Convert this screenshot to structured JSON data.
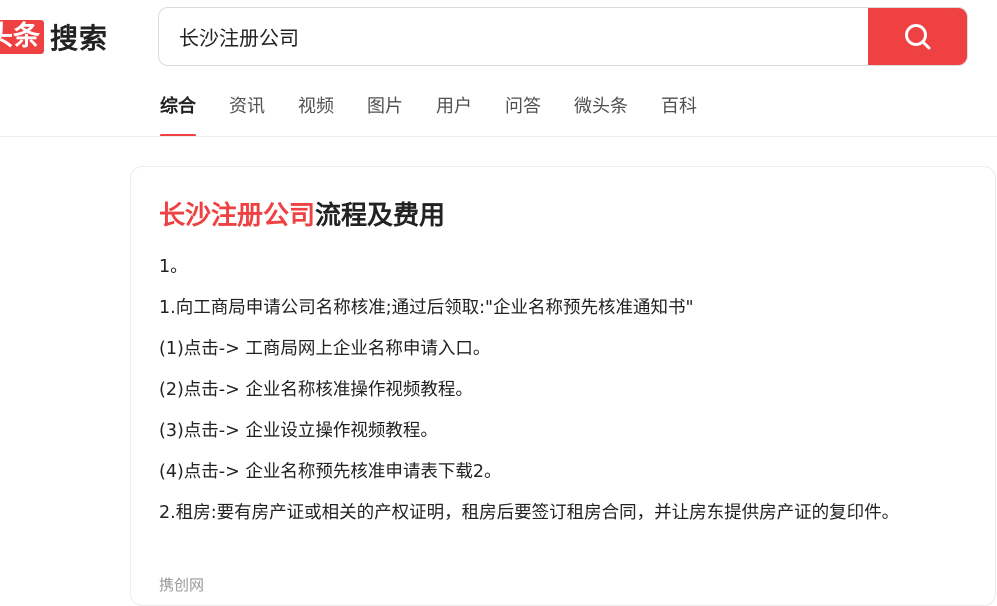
{
  "logo": {
    "badge": "头条",
    "text": "搜索"
  },
  "search": {
    "query": "长沙注册公司"
  },
  "tabs": [
    {
      "label": "综合",
      "active": true
    },
    {
      "label": "资讯"
    },
    {
      "label": "视频"
    },
    {
      "label": "图片"
    },
    {
      "label": "用户"
    },
    {
      "label": "问答"
    },
    {
      "label": "微头条"
    },
    {
      "label": "百科"
    }
  ],
  "result": {
    "title_highlight": "长沙注册公司",
    "title_rest": "流程及费用",
    "lines": [
      "1。",
      "1.向工商局申请公司名称核准;通过后领取:\"企业名称预先核准通知书\"",
      "(1)点击-> 工商局网上企业名称申请入口。",
      "(2)点击-> 企业名称核准操作视频教程。",
      "(3)点击-> 企业设立操作视频教程。",
      "(4)点击-> 企业名称预先核准申请表下载2。",
      "2.租房:要有房产证或相关的产权证明，租房后要签订租房合同，并让房东提供房产证的复印件。"
    ],
    "source": "携创网"
  },
  "colors": {
    "accent": "#f04142"
  }
}
